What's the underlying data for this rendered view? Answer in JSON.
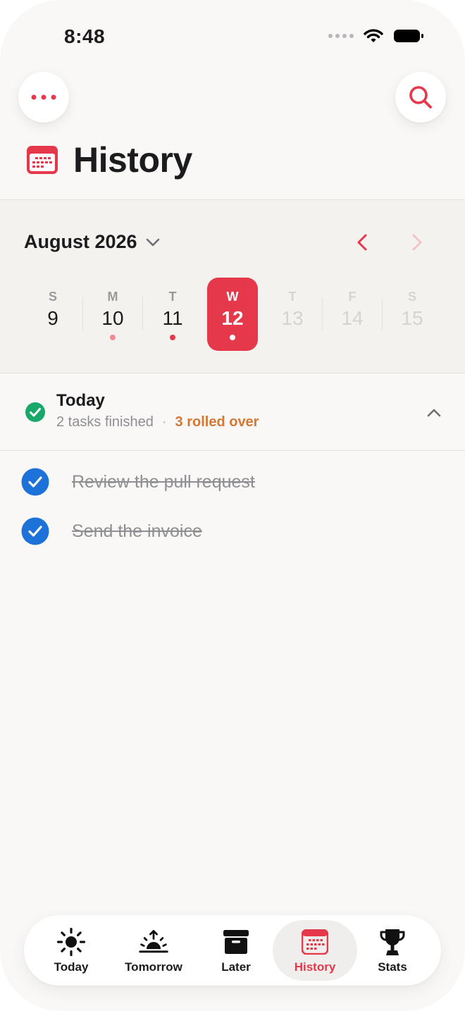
{
  "status": {
    "time": "8:48"
  },
  "header": {
    "title": "History"
  },
  "calendar": {
    "month": "August 2026",
    "days": [
      {
        "dow": "S",
        "num": "9",
        "state": "past",
        "dot": ""
      },
      {
        "dow": "M",
        "num": "10",
        "state": "past",
        "dot": "#f08a95"
      },
      {
        "dow": "T",
        "num": "11",
        "state": "past",
        "dot": "#e5384b"
      },
      {
        "dow": "W",
        "num": "12",
        "state": "selected",
        "dot": "#ffffff"
      },
      {
        "dow": "T",
        "num": "13",
        "state": "future",
        "dot": ""
      },
      {
        "dow": "F",
        "num": "14",
        "state": "future",
        "dot": ""
      },
      {
        "dow": "S",
        "num": "15",
        "state": "future",
        "dot": ""
      }
    ]
  },
  "summary": {
    "heading": "Today",
    "finished": "2 tasks finished",
    "separator": "·",
    "rolled": "3 rolled over"
  },
  "tasks": [
    {
      "text": "Review the pull request",
      "done": true
    },
    {
      "text": "Send the invoice",
      "done": true
    }
  ],
  "tabs": [
    {
      "label": "Today",
      "icon": "sun-icon"
    },
    {
      "label": "Tomorrow",
      "icon": "sunrise-icon"
    },
    {
      "label": "Later",
      "icon": "archive-box-icon"
    },
    {
      "label": "History",
      "icon": "calendar-icon",
      "active": true
    },
    {
      "label": "Stats",
      "icon": "trophy-icon"
    }
  ],
  "colors": {
    "accent": "#e5384b",
    "complete_green": "#1aa86a",
    "task_check_blue": "#1c72d9",
    "rolled_orange": "#d57834",
    "background": "#f9f8f6",
    "calendar_background": "#f4f2ef"
  }
}
